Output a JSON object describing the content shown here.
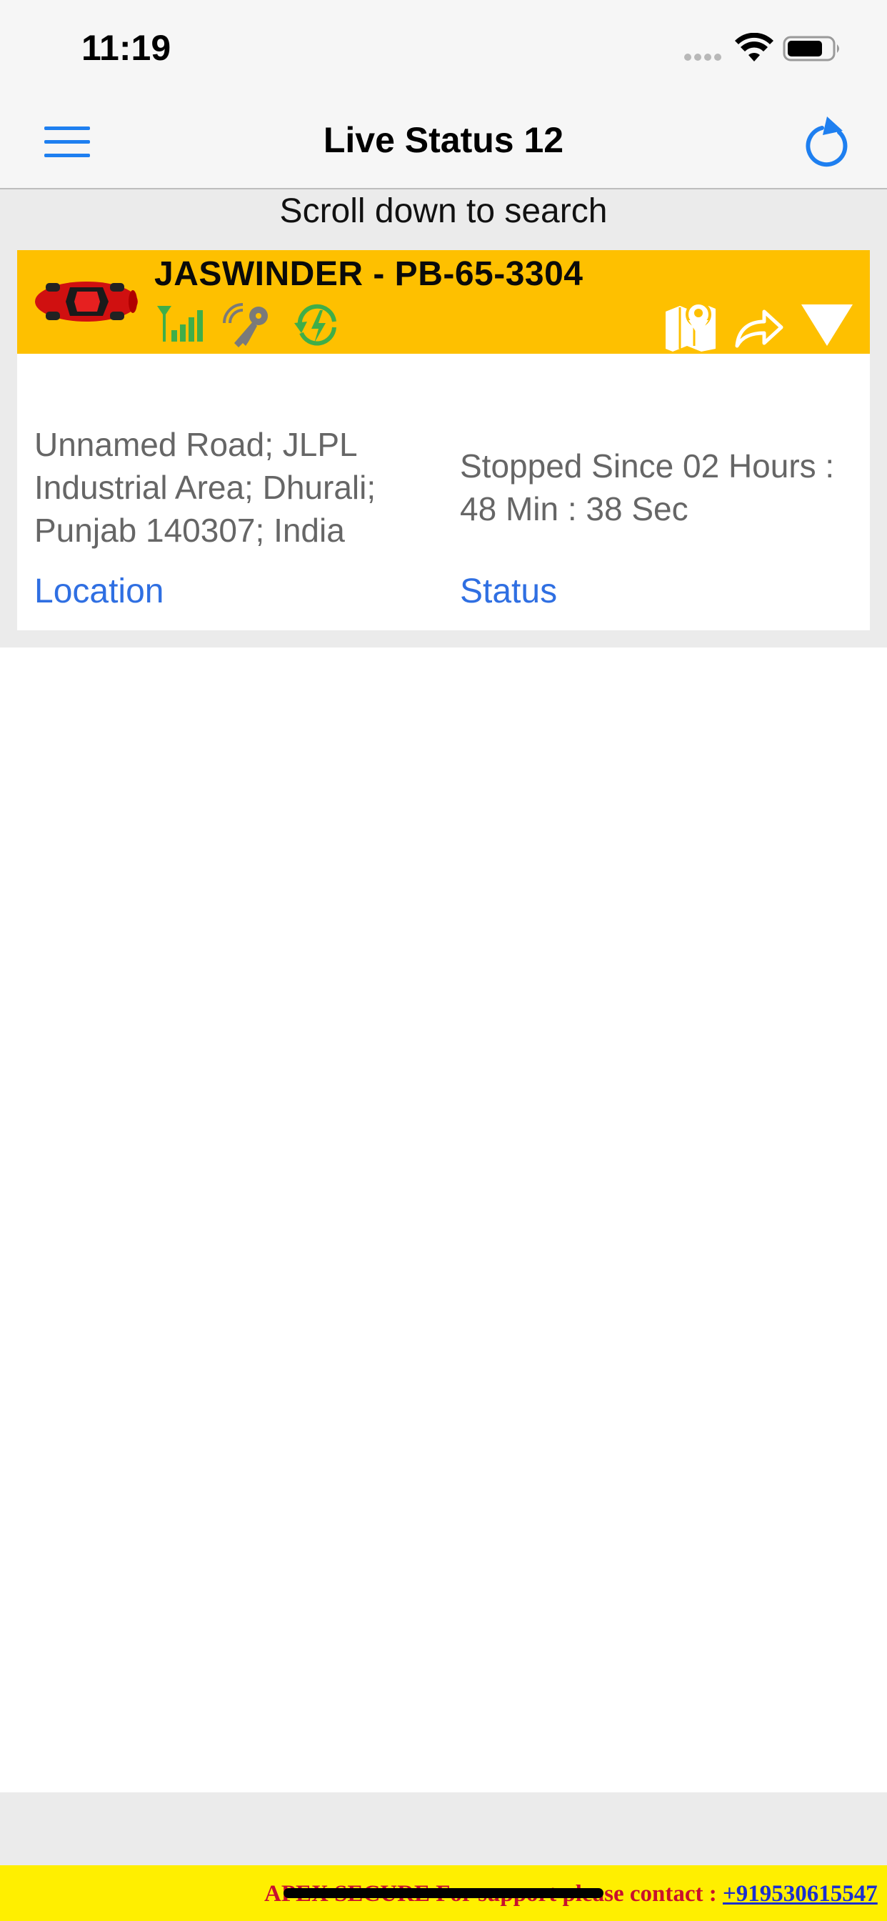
{
  "status_bar": {
    "time": "11:19"
  },
  "nav": {
    "title": "Live Status 12",
    "menu_icon": "hamburger-menu-icon",
    "refresh_icon": "refresh-icon"
  },
  "search": {
    "hint": "Scroll down to search"
  },
  "vehicle": {
    "name": "JASWINDER - PB-65-3304",
    "icons": [
      "red-car-icon",
      "gps-signal-icon",
      "ignition-key-icon",
      "power-icon",
      "map-icon",
      "share-icon",
      "collapse-triangle-icon"
    ],
    "location": "Unnamed Road; JLPL Industrial Area; Dhurali; Punjab 140307; India",
    "location_label": "Location",
    "status": "Stopped Since 02 Hours : 48 Min : 38 Sec",
    "status_label": "Status"
  },
  "footer": {
    "text": "APEX SECURE For support please contact : ",
    "phone": "+919530615547"
  },
  "colors": {
    "header_bg": "#fec000",
    "link_blue": "#2f6fe2",
    "icon_blue": "#1e7ff0",
    "footer_bg": "#ffef00",
    "footer_text": "#c8102e"
  }
}
